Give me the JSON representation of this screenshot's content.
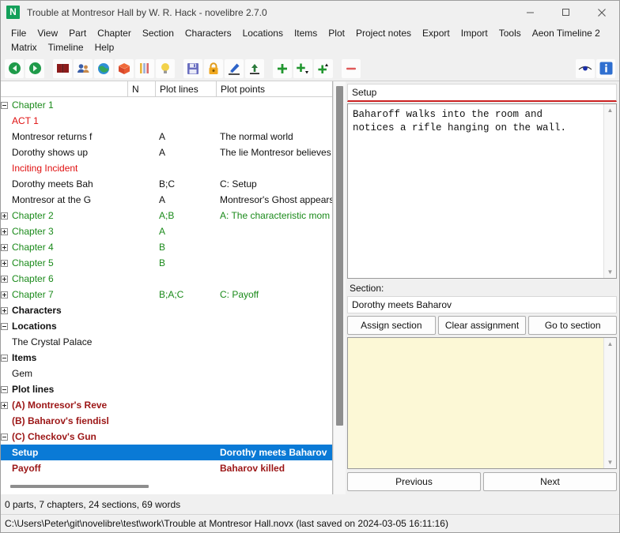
{
  "window": {
    "title": "Trouble at Montresor Hall by W. R. Hack - novelibre 2.7.0",
    "app_icon_letter": "N",
    "accent_green": "#14a05a",
    "minimize": "minimize-icon",
    "maximize": "maximize-icon",
    "close": "close-icon"
  },
  "menubar": {
    "row1": [
      "File",
      "View",
      "Part",
      "Chapter",
      "Section",
      "Characters",
      "Locations",
      "Items",
      "Plot",
      "Project notes",
      "Export",
      "Import",
      "Tools",
      "Aeon Timeline 2"
    ],
    "row2": [
      "Matrix",
      "Timeline",
      "Help"
    ]
  },
  "toolbar": {
    "left_icons": [
      "go-back-icon",
      "go-forward-icon"
    ],
    "view_icons": [
      "book-icon",
      "characters-icon",
      "locations-globe-icon",
      "items-box-icon",
      "plotlines-icon",
      "project-notes-bulb-icon"
    ],
    "file_icons": [
      "save-icon",
      "lock-icon",
      "edit-pencil-icon",
      "export-up-icon"
    ],
    "add_icons": [
      "add-icon",
      "add-child-icon",
      "add-parent-icon"
    ],
    "remove_icon": "remove-icon",
    "right_icons": [
      "toggle-view-eye-icon",
      "info-icon"
    ]
  },
  "tree": {
    "columns": [
      "",
      "N",
      "Plot lines",
      "Plot points"
    ],
    "rows": [
      {
        "indent": 1,
        "toggle": "minus",
        "title": "Chapter 1",
        "n": "",
        "plotlines": "",
        "plotpoints": "",
        "style": "c-green",
        "selected": false
      },
      {
        "indent": 2,
        "toggle": "none",
        "title": "ACT 1",
        "n": "",
        "plotlines": "",
        "plotpoints": "",
        "style": "c-red",
        "selected": false
      },
      {
        "indent": 2,
        "toggle": "none",
        "title": "Montresor returns f",
        "n": "",
        "plotlines": "A",
        "plotpoints": "The normal world",
        "style": "c-black",
        "selected": false
      },
      {
        "indent": 2,
        "toggle": "none",
        "title": "Dorothy shows up",
        "n": "",
        "plotlines": "A",
        "plotpoints": "The lie Montresor believes",
        "style": "c-black",
        "selected": false
      },
      {
        "indent": 2,
        "toggle": "none",
        "title": "Inciting Incident",
        "n": "",
        "plotlines": "",
        "plotpoints": "",
        "style": "c-red",
        "selected": false
      },
      {
        "indent": 2,
        "toggle": "none",
        "title": "Dorothy meets Bah",
        "n": "",
        "plotlines": "B;C",
        "plotpoints": "C: Setup",
        "style": "c-black",
        "selected": false
      },
      {
        "indent": 2,
        "toggle": "none",
        "title": "Montresor at the G",
        "n": "",
        "plotlines": "A",
        "plotpoints": "Montresor's Ghost appears",
        "style": "c-black",
        "selected": false
      },
      {
        "indent": 1,
        "toggle": "plus",
        "title": "Chapter 2",
        "n": "",
        "plotlines": "A;B",
        "plotpoints": "A: The characteristic mom",
        "style": "c-green",
        "selected": false
      },
      {
        "indent": 1,
        "toggle": "plus",
        "title": "Chapter 3",
        "n": "",
        "plotlines": "A",
        "plotpoints": "",
        "style": "c-green",
        "selected": false
      },
      {
        "indent": 1,
        "toggle": "plus",
        "title": "Chapter 4",
        "n": "",
        "plotlines": "B",
        "plotpoints": "",
        "style": "c-green",
        "selected": false
      },
      {
        "indent": 1,
        "toggle": "plus",
        "title": "Chapter 5",
        "n": "",
        "plotlines": "B",
        "plotpoints": "",
        "style": "c-green",
        "selected": false
      },
      {
        "indent": 1,
        "toggle": "plus",
        "title": "Chapter 6",
        "n": "",
        "plotlines": "",
        "plotpoints": "",
        "style": "c-green",
        "selected": false
      },
      {
        "indent": 1,
        "toggle": "plus",
        "title": "Chapter 7",
        "n": "",
        "plotlines": "B;A;C",
        "plotpoints": "C: Payoff",
        "style": "c-green",
        "selected": false
      },
      {
        "indent": 0,
        "toggle": "plus",
        "title": "Characters",
        "n": "",
        "plotlines": "",
        "plotpoints": "",
        "style": "c-bold",
        "selected": false
      },
      {
        "indent": 0,
        "toggle": "minus",
        "title": "Locations",
        "n": "",
        "plotlines": "",
        "plotpoints": "",
        "style": "c-bold",
        "selected": false
      },
      {
        "indent": 1,
        "toggle": "none",
        "title": "The Crystal Palace",
        "n": "",
        "plotlines": "",
        "plotpoints": "",
        "style": "c-black",
        "selected": false
      },
      {
        "indent": 0,
        "toggle": "minus",
        "title": "Items",
        "n": "",
        "plotlines": "",
        "plotpoints": "",
        "style": "c-bold",
        "selected": false
      },
      {
        "indent": 1,
        "toggle": "none",
        "title": "Gem",
        "n": "",
        "plotlines": "",
        "plotpoints": "",
        "style": "c-black",
        "selected": false
      },
      {
        "indent": 0,
        "toggle": "minus",
        "title": "Plot lines",
        "n": "",
        "plotlines": "",
        "plotpoints": "",
        "style": "c-bold",
        "selected": false
      },
      {
        "indent": 1,
        "toggle": "plus",
        "title": "(A) Montresor's Reve",
        "n": "",
        "plotlines": "",
        "plotpoints": "",
        "style": "c-dred",
        "selected": false
      },
      {
        "indent": 1,
        "toggle": "none",
        "title": "(B) Baharov's fiendisl",
        "n": "",
        "plotlines": "",
        "plotpoints": "",
        "style": "c-dred",
        "selected": false
      },
      {
        "indent": 1,
        "toggle": "minus",
        "title": "(C) Checkov's Gun",
        "n": "",
        "plotlines": "",
        "plotpoints": "",
        "style": "c-dred",
        "selected": false
      },
      {
        "indent": 2,
        "toggle": "none",
        "title": "Setup",
        "n": "",
        "plotlines": "",
        "plotpoints": "Dorothy meets Baharov",
        "style": "c-dred",
        "selected": true
      },
      {
        "indent": 2,
        "toggle": "none",
        "title": "Payoff",
        "n": "",
        "plotlines": "",
        "plotpoints": "Baharov killed",
        "style": "c-dred",
        "selected": false
      }
    ]
  },
  "right_panel": {
    "element_title": "Setup",
    "description": "Baharoff walks into the room and\nnotices a rifle hanging on the wall.",
    "section_label": "Section:",
    "section_value": "Dorothy meets Baharov",
    "assign_button": "Assign section",
    "clear_button": "Clear assignment",
    "goto_button": "Go to section",
    "notes_value": "",
    "previous_button": "Previous",
    "next_button": "Next",
    "title_underline_color": "#cc2222",
    "notes_background": "#fcf8d6"
  },
  "status": {
    "counts": "0 parts, 7 chapters, 24 sections, 69 words",
    "path": "C:\\Users\\Peter\\git\\novelibre\\test\\work\\Trouble at Montresor Hall.novx (last saved on 2024-03-05 16:11:16)"
  }
}
